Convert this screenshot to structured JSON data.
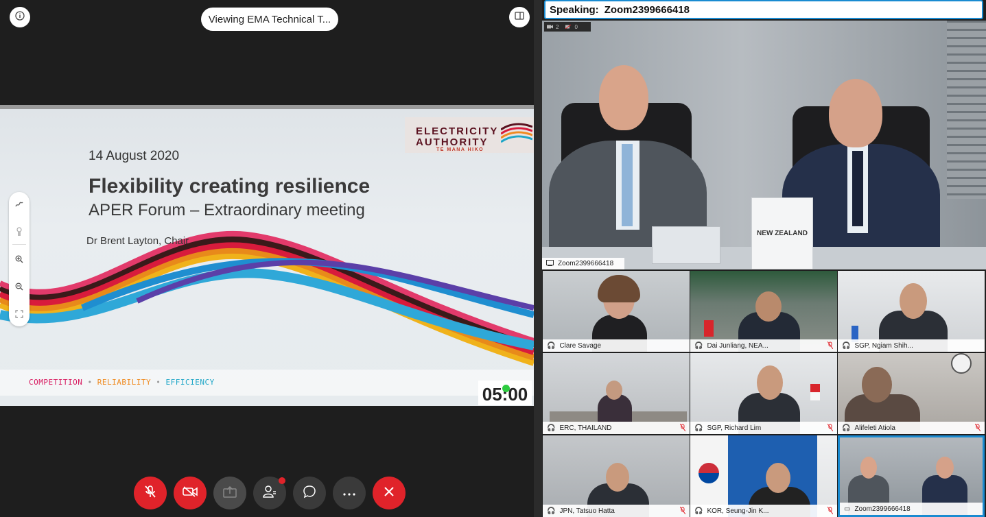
{
  "viewing_pill": "Viewing EMA Technical T...",
  "slide": {
    "logo": {
      "line1": "ELECTRICITY",
      "line2": "AUTHORITY",
      "line3": "TE MANA HIKO"
    },
    "date": "14 August 2020",
    "title": "Flexibility creating resilience",
    "subtitle": "APER Forum – Extraordinary meeting",
    "presenter": "Dr Brent Layton, Chair",
    "footer": {
      "competition": "COMPETITION",
      "reliability": "RELIABILITY",
      "efficiency": "EFFICIENCY",
      "sep": "•"
    },
    "timer": "05:00"
  },
  "speaking": {
    "label": "Speaking:",
    "name": "Zoom2399666418"
  },
  "counts": {
    "video": "2",
    "muted": "0"
  },
  "main_video": {
    "label": "Zoom2399666418",
    "placard": "NEW ZEALAND"
  },
  "tiles": [
    {
      "name": "Clare Savage",
      "muted": false
    },
    {
      "name": "Dai Junliang, NEA...",
      "muted": true
    },
    {
      "name": "SGP, Ngiam Shih...",
      "muted": false
    },
    {
      "name": "ERC, THAILAND",
      "muted": true
    },
    {
      "name": "SGP, Richard Lim",
      "muted": true
    },
    {
      "name": "Alifeleti Atiola",
      "muted": true
    },
    {
      "name": "JPN, Tatsuo Hatta",
      "muted": true
    },
    {
      "name": "KOR, Seung-Jin K...",
      "muted": true
    },
    {
      "name": "Zoom2399666418",
      "muted": false
    }
  ],
  "colors": {
    "accent_red": "#e0232a",
    "active_border": "#1a8bd1",
    "brand": "#5b1220"
  }
}
